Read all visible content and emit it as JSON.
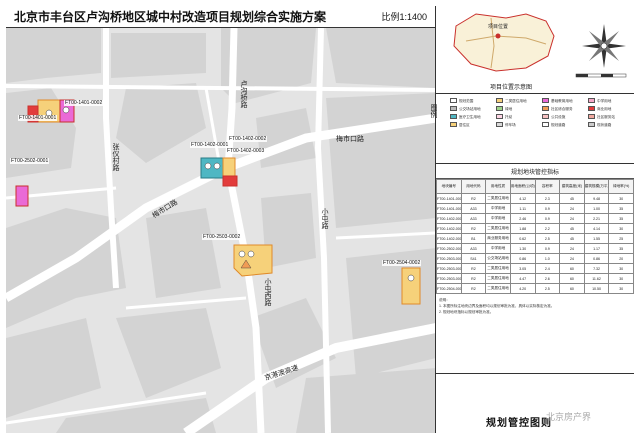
{
  "header": {
    "title": "北京市丰台区卢沟桥地区城中村改造项目规划综合实施方案",
    "scale": "比例1:1400"
  },
  "map": {
    "roads": {
      "north_road": "卢沟桥路",
      "west_road": "张仪村路",
      "meishikou_road_1": "梅市口路",
      "meishikou_road_2": "梅市口路",
      "xiaotun_road": "小屯路",
      "xiaotun_west_road": "小屯西路",
      "jingxi_road": "京港澳高速"
    },
    "plots": {
      "p1": "FT00-1401-0002",
      "p2": "FT00-1401-0001",
      "p3": "FT00-2502-0001",
      "p4": "FT00-1402-0002",
      "p5": "FT00-1402-0001",
      "p6": "FT00-1402-0003",
      "p7": "FT00-2503-0002",
      "p8": "FT00-2504-0002"
    }
  },
  "location_map": {
    "caption": "项目位置示意图",
    "marker_label": "项目位置"
  },
  "legend": {
    "heading": "图例",
    "items": [
      {
        "label": "规划范围",
        "color": "#ffffff"
      },
      {
        "label": "二类居住用地",
        "color": "#f6d17a"
      },
      {
        "label": "基础教育用地",
        "color": "#ea6ad6"
      },
      {
        "label": "中学用地",
        "color": "#f4a8c8"
      },
      {
        "label": "公交场站用地",
        "color": "#b9b9b9"
      },
      {
        "label": "绿地",
        "color": "#9fd48a"
      },
      {
        "label": "社区综合服务",
        "color": "#f09c55"
      },
      {
        "label": "商业用地",
        "color": "#e23b3b"
      },
      {
        "label": "医疗卫生用地",
        "color": "#4fb7c3"
      },
      {
        "label": "托幼",
        "color": "#ffd6e6"
      },
      {
        "label": "公共设施",
        "color": "#f7c1c1"
      },
      {
        "label": "社区服务站",
        "color": "#f1a9a0"
      },
      {
        "label": "居住区",
        "color": "#f6d17a"
      },
      {
        "label": "停车场",
        "color": "#d9d9d9"
      },
      {
        "label": "规划道路",
        "color": "#ffffff"
      },
      {
        "label": "现状道路",
        "color": "#cccccc"
      }
    ]
  },
  "control_table": {
    "title": "规划地块管控指标",
    "headers": [
      "地块编号",
      "用地代码",
      "用地性质",
      "用地面积(公顷)",
      "容积率",
      "建筑高度(米)",
      "建筑规模(万平方米)",
      "绿地率(%)"
    ],
    "rows": [
      [
        "FT00-1401-0001",
        "R2",
        "二类居住用地",
        "4.12",
        "2.3",
        "45",
        "9.48",
        "30"
      ],
      [
        "FT00-1401-0002",
        "A33",
        "中学用地",
        "1.11",
        "0.9",
        "24",
        "1.00",
        "35"
      ],
      [
        "FT00-1402-0001",
        "A33",
        "中学用地",
        "2.46",
        "0.9",
        "24",
        "2.21",
        "35"
      ],
      [
        "FT00-1402-0002",
        "R2",
        "二类居住用地",
        "1.88",
        "2.2",
        "45",
        "4.14",
        "30"
      ],
      [
        "FT00-1402-0003",
        "B1",
        "商业服务用地",
        "0.62",
        "2.5",
        "45",
        "1.55",
        "25"
      ],
      [
        "FT00-2502-0001",
        "A33",
        "中学用地",
        "1.30",
        "0.9",
        "24",
        "1.17",
        "35"
      ],
      [
        "FT00-2503-0001",
        "S41",
        "公交场站用地",
        "0.86",
        "1.0",
        "24",
        "0.86",
        "20"
      ],
      [
        "FT00-2503-0002",
        "R2",
        "二类居住用地",
        "3.05",
        "2.4",
        "60",
        "7.32",
        "30"
      ],
      [
        "FT00-2503-0003",
        "R2",
        "二类居住用地",
        "4.47",
        "2.6",
        "60",
        "11.62",
        "30"
      ],
      [
        "FT00-2504-0002",
        "R2",
        "二类居住用地",
        "4.20",
        "2.5",
        "60",
        "10.50",
        "30"
      ]
    ],
    "notes": [
      "说明：",
      "1. 本图所标注地块边界及面积均以规划审批为准，具体以实际核定为准。",
      "2. 规划地块指标以规划审批为准。"
    ]
  },
  "footer": {
    "title": "规划管控图则",
    "watermark": "北京房产界"
  },
  "colors": {
    "residential": "#f6d17a",
    "residential_stroke": "#e08a2a",
    "school": "#ea6ad6",
    "medical": "#4fb7c3",
    "commercial": "#e23b3b",
    "boundary": "#c9302c",
    "road": "#ffffff",
    "block": "#d3d3d3",
    "block_light": "#e4e4e4"
  }
}
